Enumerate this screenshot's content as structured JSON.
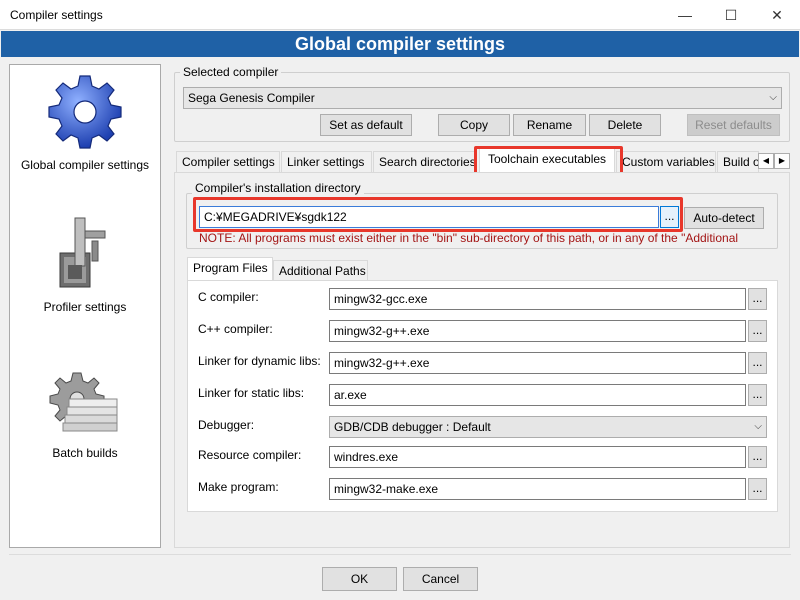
{
  "window": {
    "title": "Compiler settings",
    "minimize": "—",
    "maximize": "☐",
    "close": "✕"
  },
  "banner": "Global compiler settings",
  "sidebar": {
    "items": [
      {
        "label": "Global compiler settings",
        "icon": "gear-icon",
        "selected": true
      },
      {
        "label": "Profiler settings",
        "icon": "caliper-icon",
        "selected": false
      },
      {
        "label": "Batch builds",
        "icon": "batch-gear-icon",
        "selected": false
      }
    ]
  },
  "selected_compiler": {
    "legend": "Selected compiler",
    "value": "Sega Genesis Compiler"
  },
  "compiler_buttons": {
    "set_default": "Set as default",
    "copy": "Copy",
    "rename": "Rename",
    "delete": "Delete",
    "reset_defaults": "Reset defaults"
  },
  "tabs": [
    {
      "label": "Compiler settings",
      "active": false
    },
    {
      "label": "Linker settings",
      "active": false
    },
    {
      "label": "Search directories",
      "active": false
    },
    {
      "label": "Toolchain executables",
      "active": true
    },
    {
      "label": "Custom variables",
      "active": false
    },
    {
      "label": "Build o",
      "active": false
    }
  ],
  "install_dir": {
    "legend": "Compiler's installation directory",
    "value": "C:¥MEGADRIVE¥sgdk122",
    "browse": "...",
    "auto_detect": "Auto-detect",
    "note": "NOTE: All programs must exist either in the \"bin\" sub-directory of this path, or in any of the \"Additional"
  },
  "sub_tabs": [
    {
      "label": "Program Files",
      "active": true
    },
    {
      "label": "Additional Paths",
      "active": false
    }
  ],
  "programs": [
    {
      "label": "C compiler:",
      "value": "mingw32-gcc.exe",
      "kind": "text"
    },
    {
      "label": "C++ compiler:",
      "value": "mingw32-g++.exe",
      "kind": "text"
    },
    {
      "label": "Linker for dynamic libs:",
      "value": "mingw32-g++.exe",
      "kind": "text"
    },
    {
      "label": "Linker for static libs:",
      "value": "ar.exe",
      "kind": "text"
    },
    {
      "label": "Debugger:",
      "value": "GDB/CDB debugger : Default",
      "kind": "select"
    },
    {
      "label": "Resource compiler:",
      "value": "windres.exe",
      "kind": "text"
    },
    {
      "label": "Make program:",
      "value": "mingw32-make.exe",
      "kind": "text"
    }
  ],
  "browse_label": "...",
  "footer": {
    "ok": "OK",
    "cancel": "Cancel"
  },
  "colors": {
    "banner": "#1f61a6",
    "highlight": "#e8372b",
    "note": "#a31515"
  }
}
